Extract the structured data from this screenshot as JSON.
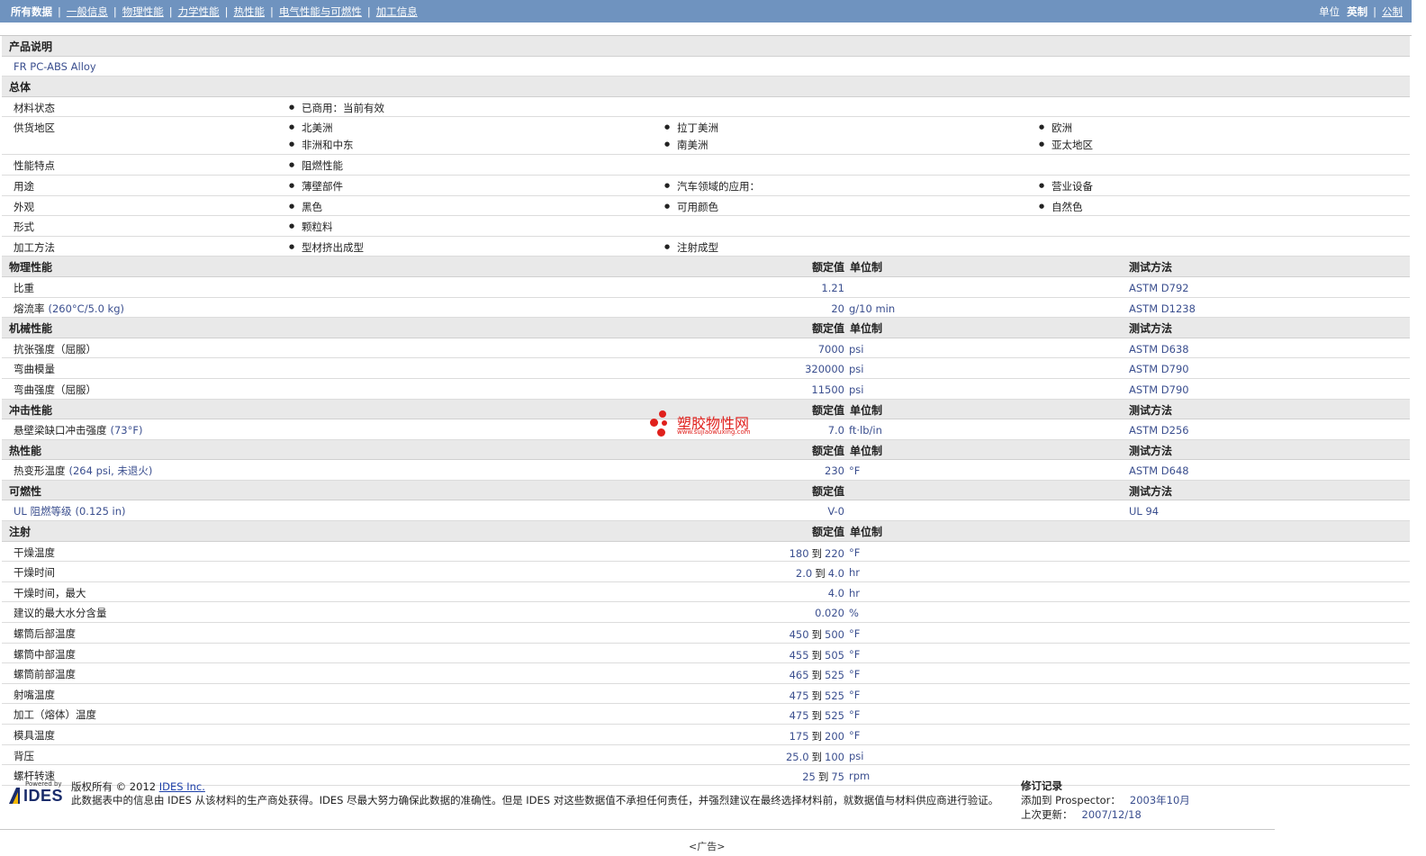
{
  "nav": {
    "tabs": [
      "所有数据",
      "一般信息",
      "物理性能",
      "力学性能",
      "热性能",
      "电气性能与可燃性",
      "加工信息"
    ],
    "units_label": "单位",
    "unit_english": "英制",
    "unit_metric": "公制"
  },
  "product": {
    "section": "产品说明",
    "description": "FR PC-ABS Alloy"
  },
  "general": {
    "section": "总体",
    "material_status": {
      "label": "材料状态",
      "items": [
        "已商用：当前有效"
      ]
    },
    "availability": {
      "label": "供货地区",
      "items": [
        "北美洲",
        "拉丁美洲",
        "欧洲",
        "非洲和中东",
        "南美洲",
        "亚太地区"
      ]
    },
    "features": {
      "label": "性能特点",
      "items": [
        "阻燃性能"
      ]
    },
    "uses": {
      "label": "用途",
      "items": [
        "薄壁部件",
        "汽车领域的应用：",
        "营业设备"
      ]
    },
    "appearance": {
      "label": "外观",
      "items": [
        "黑色",
        "可用颜色",
        "自然色"
      ]
    },
    "form": {
      "label": "形式",
      "items": [
        "颗粒料"
      ]
    },
    "processing": {
      "label": "加工方法",
      "items": [
        "型材挤出成型",
        "注射成型"
      ]
    }
  },
  "headers": {
    "nominal": "额定值",
    "unit": "单位制",
    "method": "测试方法"
  },
  "physical": {
    "section": "物理性能",
    "rows": [
      {
        "label": "比重",
        "cond": "",
        "value": "1.21",
        "unit": "",
        "method": "ASTM D792"
      },
      {
        "label": "熔流率",
        "cond": "(260°C/5.0 kg)",
        "value": "20",
        "unit": "g/10 min",
        "method": "ASTM D1238"
      }
    ]
  },
  "mechanical": {
    "section": "机械性能",
    "rows": [
      {
        "label": "抗张强度（屈服）",
        "value": "7000",
        "unit": "psi",
        "method": "ASTM D638"
      },
      {
        "label": "弯曲模量",
        "value": "320000",
        "unit": "psi",
        "method": "ASTM D790"
      },
      {
        "label": "弯曲强度（屈服）",
        "value": "11500",
        "unit": "psi",
        "method": "ASTM D790"
      }
    ]
  },
  "impact": {
    "section": "冲击性能",
    "rows": [
      {
        "label": "悬壁梁缺口冲击强度",
        "cond": "(73°F)",
        "value": "7.0",
        "unit": "ft·lb/in",
        "method": "ASTM D256"
      }
    ]
  },
  "thermal": {
    "section": "热性能",
    "rows": [
      {
        "label": "热变形温度",
        "cond": "(264 psi, 未退火)",
        "value": "230",
        "unit": "°F",
        "method": "ASTM D648"
      }
    ]
  },
  "flammability": {
    "section": "可燃性",
    "rows": [
      {
        "label": "UL 阻燃等级",
        "cond": "(0.125 in)",
        "value": "V-0",
        "unit": "",
        "method": "UL 94"
      }
    ]
  },
  "injection": {
    "section": "注射",
    "to": "到",
    "rows": [
      {
        "label": "干燥温度",
        "min": "180",
        "max": "220",
        "unit": "°F"
      },
      {
        "label": "干燥时间",
        "min": "2.0",
        "max": "4.0",
        "unit": "hr"
      },
      {
        "label": "干燥时间，最大",
        "min": "",
        "max": "4.0",
        "unit": "hr"
      },
      {
        "label": "建议的最大水分含量",
        "min": "",
        "max": "0.020",
        "unit": "%"
      },
      {
        "label": "螺筒后部温度",
        "min": "450",
        "max": "500",
        "unit": "°F"
      },
      {
        "label": "螺筒中部温度",
        "min": "455",
        "max": "505",
        "unit": "°F"
      },
      {
        "label": "螺筒前部温度",
        "min": "465",
        "max": "525",
        "unit": "°F"
      },
      {
        "label": "射嘴温度",
        "min": "475",
        "max": "525",
        "unit": "°F"
      },
      {
        "label": "加工（熔体）温度",
        "min": "475",
        "max": "525",
        "unit": "°F"
      },
      {
        "label": "模具温度",
        "min": "175",
        "max": "200",
        "unit": "°F"
      },
      {
        "label": "背压",
        "min": "25.0",
        "max": "100",
        "unit": "psi"
      },
      {
        "label": "螺杆转速",
        "min": "25",
        "max": "75",
        "unit": "rpm"
      }
    ]
  },
  "watermark": {
    "name": "塑胶物性网",
    "url": "www.sujiaowuxing.com"
  },
  "footer": {
    "logo_powered": "Powered by",
    "logo_name": "IDES",
    "copyright_prefix": "版权所有 © 2012",
    "copyright_link": "IDES Inc.",
    "disclaimer": "此数据表中的信息由 IDES 从该材料的生产商处获得。IDES 尽最大努力确保此数据的准确性。但是 IDES 对这些数据值不承担任何责任，并强烈建议在最终选择材料前，就数据值与材料供应商进行验证。",
    "revision_title": "修订记录",
    "added_label": "添加到 Prospector：",
    "added_value": "2003年10月",
    "updated_label": "上次更新：",
    "updated_value": "2007/12/18",
    "ad": "<广告>"
  },
  "colors": {
    "nav_bg": "#6f93bf",
    "value_text": "#3b4f8f",
    "header_bg": "#e9e9e9",
    "watermark": "#e0201c"
  }
}
